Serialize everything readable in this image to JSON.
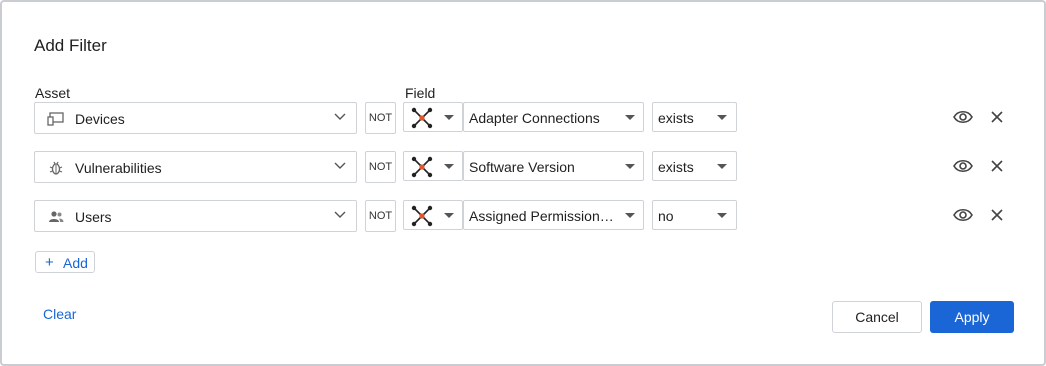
{
  "dialog": {
    "title": "Add Filter",
    "asset_column_label": "Asset",
    "field_column_label": "Field"
  },
  "rows": [
    {
      "asset": "Devices",
      "asset_icon": "devices-icon",
      "not_label": "NOT",
      "adapter_icon": "adapter-network-icon",
      "field": "Adapter Connections",
      "operator": "exists"
    },
    {
      "asset": "Vulnerabilities",
      "asset_icon": "bug-icon",
      "not_label": "NOT",
      "adapter_icon": "adapter-network-icon",
      "field": "Software Version",
      "operator": "exists"
    },
    {
      "asset": "Users",
      "asset_icon": "users-icon",
      "not_label": "NOT",
      "adapter_icon": "adapter-network-icon",
      "field": "Assigned Permissions…",
      "operator": "no"
    }
  ],
  "actions": {
    "add_label": "Add",
    "clear_label": "Clear",
    "cancel_label": "Cancel",
    "apply_label": "Apply"
  },
  "colors": {
    "accent": "#1a66d6",
    "adapter_center": "#e8542a",
    "border": "#cfd2d6"
  }
}
